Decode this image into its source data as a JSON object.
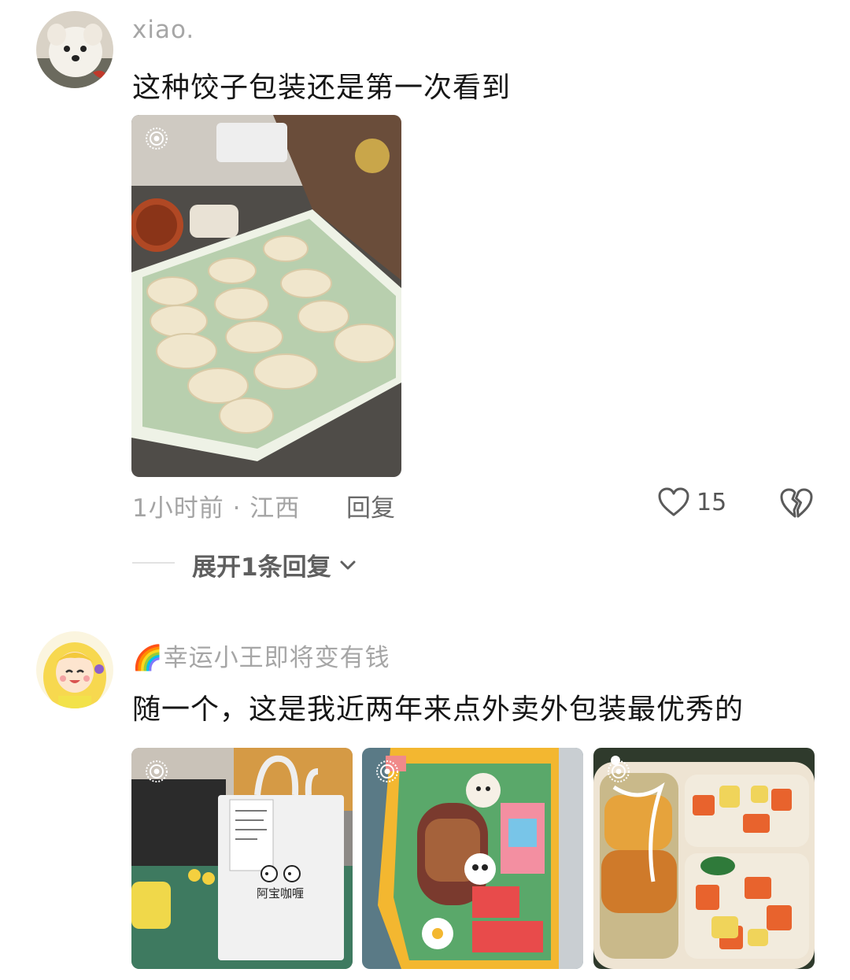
{
  "comments": [
    {
      "username": "xiao.",
      "text": "这种饺子包装还是第一次看到",
      "time_location": "1小时前 · 江西",
      "reply_label": "回复",
      "likes": "15",
      "expand_label": "展开1条回复"
    },
    {
      "username_emoji": "🌈",
      "username": "幸运小王即将变有钱",
      "text": "随一个，这是我近两年来点外卖外包装最优秀的"
    }
  ],
  "photo_texts": {
    "bag_brand": "阿宝咖喱"
  },
  "icons": {
    "like": "heart-icon",
    "dislike": "broken-heart-icon",
    "expand": "chevron-down-icon",
    "live": "live-photo-icon"
  }
}
